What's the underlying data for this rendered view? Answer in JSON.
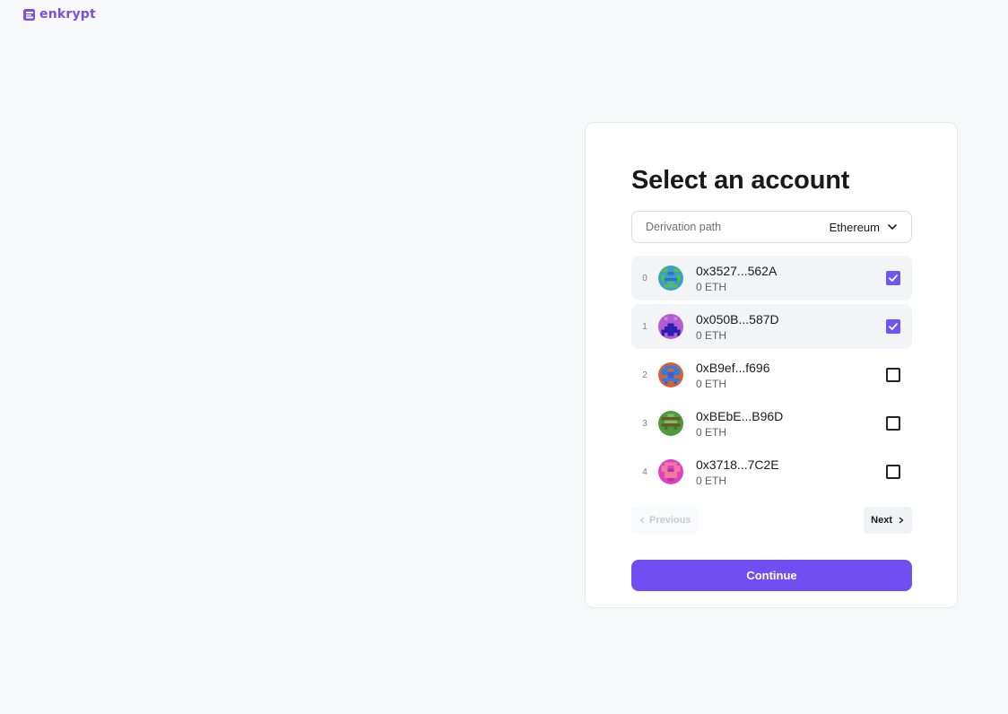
{
  "app": {
    "brand": "enkrypt",
    "brand_color": "#7b4de0",
    "accent_color": "#6f4ff2"
  },
  "card": {
    "title": "Select an account",
    "derivation": {
      "label": "Derivation path",
      "value": "Ethereum",
      "icon": "chevron-down-icon"
    },
    "accounts": [
      {
        "index": "0",
        "address": "0x3527...562A",
        "balance": "0 ETH",
        "checked": true
      },
      {
        "index": "1",
        "address": "0x050B...587D",
        "balance": "0 ETH",
        "checked": true
      },
      {
        "index": "2",
        "address": "0xB9ef...f696",
        "balance": "0 ETH",
        "checked": false
      },
      {
        "index": "3",
        "address": "0xBEbE...B96D",
        "balance": "0 ETH",
        "checked": false
      },
      {
        "index": "4",
        "address": "0x3718...7C2E",
        "balance": "0 ETH",
        "checked": false
      }
    ],
    "pagination": {
      "previous_label": "Previous",
      "next_label": "Next",
      "previous_disabled": true
    },
    "continue_label": "Continue"
  }
}
